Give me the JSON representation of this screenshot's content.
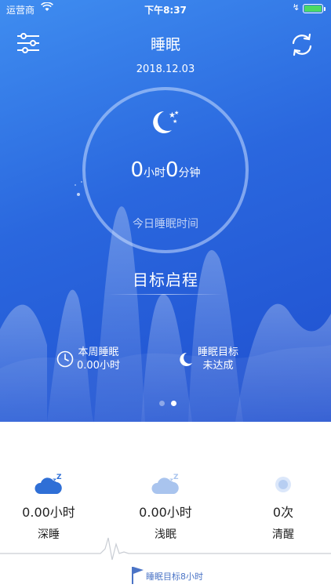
{
  "status_bar": {
    "carrier": "运营商",
    "time": "下午8:37",
    "battery_level": 1.0,
    "battery_color": "#4cd964"
  },
  "header": {
    "title": "睡眠",
    "date": "2018.12.03",
    "settings_icon": "sliders-icon",
    "refresh_icon": "refresh-icon"
  },
  "ring": {
    "icon": "moon-stars-icon",
    "hours": "0",
    "hours_unit": "小时",
    "minutes": "0",
    "minutes_unit": "分钟",
    "caption": "今日睡眠时间"
  },
  "target": {
    "label": "目标启程"
  },
  "summary": {
    "week_label": "本周睡眠",
    "week_value": "0.00小时",
    "goal_label": "睡眠目标",
    "goal_value": "未达成"
  },
  "pager": {
    "count": 2,
    "active_index": 1
  },
  "metrics": [
    {
      "icon": "deep-sleep-cloud-icon",
      "value": "0.00小时",
      "label": "深睡"
    },
    {
      "icon": "light-sleep-cloud-icon",
      "value": "0.00小时",
      "label": "浅眠"
    },
    {
      "icon": "awake-circle-icon",
      "value": "0次",
      "label": "清醒"
    }
  ],
  "footer": {
    "goal_text": "睡眠目标8小时",
    "accent_color": "#4b74c6"
  },
  "colors": {
    "hero_top": "#3f8df0",
    "hero_bottom": "#1f4fcf"
  }
}
